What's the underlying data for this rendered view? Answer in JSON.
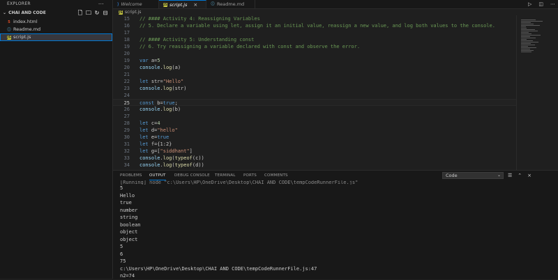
{
  "explorer": {
    "title": "EXPLORER",
    "folder": "CHAI AND CODE",
    "files": [
      {
        "name": "index.html",
        "icon": "html-file-icon",
        "active": false
      },
      {
        "name": "Readme.md",
        "icon": "info-file-icon",
        "active": false
      },
      {
        "name": "script.js",
        "icon": "js-file-icon",
        "active": true
      }
    ]
  },
  "tabs": [
    {
      "label": "Welcome",
      "icon": "vscode-logo-icon"
    },
    {
      "label": "script.js",
      "icon": "js-file-icon"
    },
    {
      "label": "Readme.md",
      "icon": "info-file-icon"
    }
  ],
  "breadcrumb": "script.js",
  "editor": {
    "lines": [
      {
        "n": "15",
        "text": "// #### Activity 4: Reassigning Variables"
      },
      {
        "n": "16",
        "text": "// 5. Declare a variable using let, assign it an initial value, reassign a new value, and log both values to the console."
      },
      {
        "n": "17",
        "text": ""
      },
      {
        "n": "18",
        "text": "// #### Activity 5: Understanding const"
      },
      {
        "n": "19",
        "text": "// 6. Try reassigning a variable declared with const and observe the error."
      },
      {
        "n": "20",
        "text": ""
      },
      {
        "n": "19",
        "text": "var a=5"
      },
      {
        "n": "20",
        "text": "console.log(a)"
      },
      {
        "n": "21",
        "text": ""
      },
      {
        "n": "22",
        "text": "let str=\"Hello\""
      },
      {
        "n": "23",
        "text": "console.log(str)"
      },
      {
        "n": "24",
        "text": ""
      },
      {
        "n": "25",
        "text": "const b=true;"
      },
      {
        "n": "26",
        "text": "console.log(b)"
      },
      {
        "n": "27",
        "text": ""
      },
      {
        "n": "28",
        "text": "let c=4"
      },
      {
        "n": "29",
        "text": "let d=\"hello\""
      },
      {
        "n": "30",
        "text": "let e=true"
      },
      {
        "n": "31",
        "text": "let f={1:2}"
      },
      {
        "n": "32",
        "text": "let g=[\"siddhant\"]"
      },
      {
        "n": "33",
        "text": "console.log(typeof(c))"
      },
      {
        "n": "34",
        "text": "console.log(typeof(d))"
      }
    ],
    "current_line": "25"
  },
  "panel": {
    "tabs": [
      "PROBLEMS",
      "OUTPUT",
      "DEBUG CONSOLE",
      "TERMINAL",
      "PORTS",
      "COMMENTS"
    ],
    "active_tab": "OUTPUT",
    "select_value": "Code",
    "output_lines": [
      "[Running] node \"c:\\Users\\HP\\OneDrive\\Desktop\\CHAI AND CODE\\tempCodeRunnerFile.js\"",
      "5",
      "Hello",
      "true",
      "number",
      "string",
      "boolean",
      "object",
      "object",
      "5",
      "6",
      "75",
      "c:\\Users\\HP\\OneDrive\\Desktop\\CHAI AND CODE\\tempCodeRunnerFile.js:47",
      "n2=74"
    ]
  },
  "colors": {
    "accent": "#0078d4",
    "comment": "#6a9955",
    "keyword": "#569cd6",
    "string": "#ce9178"
  }
}
